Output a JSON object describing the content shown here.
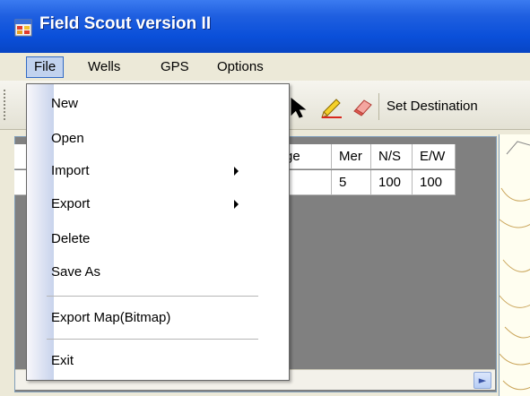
{
  "window": {
    "title": "Field Scout version II"
  },
  "menubar": {
    "items": [
      {
        "label": "File"
      },
      {
        "label": "Wells"
      },
      {
        "label": "GPS"
      },
      {
        "label": "Options"
      }
    ]
  },
  "toolbar": {
    "set_destination_label": "Set Destination",
    "icons": [
      "cursor-icon",
      "pencil-icon",
      "eraser-icon"
    ]
  },
  "file_menu": {
    "items": [
      {
        "label": "New"
      },
      {
        "label": "Open"
      },
      {
        "label": "Import"
      },
      {
        "label": "Export"
      },
      {
        "label": "Delete"
      },
      {
        "label": "Save As"
      },
      {
        "label": "Export Map(Bitmap)"
      },
      {
        "label": "Exit"
      }
    ]
  },
  "grid": {
    "columns": [
      "ge",
      "Mer",
      "N/S",
      "E/W"
    ],
    "rows": [
      [
        "",
        "5",
        "100",
        "100"
      ]
    ]
  },
  "colors": {
    "titlebar": "#0a4fd9",
    "grid_background": "#808080",
    "menu_highlight": "#c1d2ee"
  }
}
